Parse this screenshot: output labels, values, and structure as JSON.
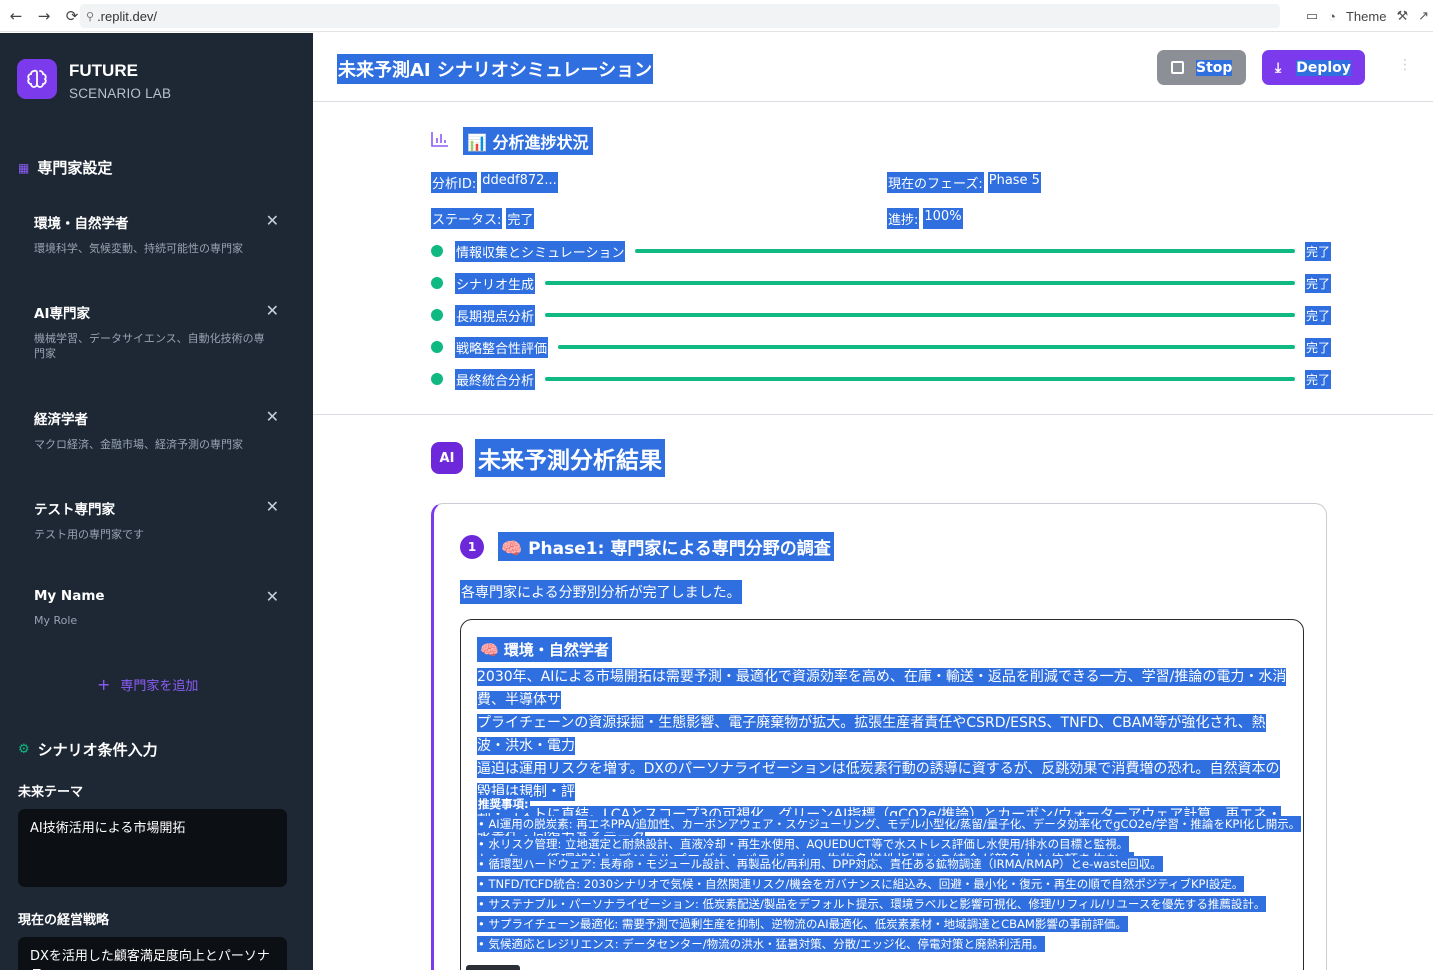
{
  "browser": {
    "url": ".replit.dev/",
    "theme_label": "Theme"
  },
  "sidebar": {
    "brand_title": "FUTURE",
    "brand_subtitle": "SCENARIO LAB",
    "experts_section_title": "専門家設定",
    "experts": [
      {
        "name": "環境・自然学者",
        "desc": "環境科学、気候変動、持続可能性の専門家"
      },
      {
        "name": "AI専門家",
        "desc": "機械学習、データサイエンス、自動化技術の専門家"
      },
      {
        "name": "経済学者",
        "desc": "マクロ経済、金融市場、経済予測の専門家"
      },
      {
        "name": "テスト専門家",
        "desc": "テスト用の専門家です"
      },
      {
        "name": "My Name",
        "desc": "My Role"
      }
    ],
    "add_expert_label": "専門家を追加",
    "scenario_section_title": "シナリオ条件入力",
    "future_theme_label": "未来テーマ",
    "future_theme_value": "AI技術活用による市場開拓",
    "strategy_label": "現在の経営戦略",
    "strategy_value": "DXを活用した顧客満足度向上とパーソナラ"
  },
  "header": {
    "title": "未来予測AI シナリオシミュレーション",
    "stop_label": "Stop",
    "deploy_label": "Deploy"
  },
  "progress": {
    "title": "📊 分析進捗状況",
    "analysis_id_label": "分析ID:",
    "analysis_id_value": "ddedf872...",
    "phase_label": "現在のフェーズ:",
    "phase_value": "Phase 5",
    "status_label": "ステータス:",
    "status_value": "完了",
    "progress_label": "進捗:",
    "progress_value": "100%",
    "steps": [
      {
        "label": "情報収集とシミュレーション",
        "status": "完了",
        "fraction": 1.0
      },
      {
        "label": "シナリオ生成",
        "status": "完了",
        "fraction": 1.0
      },
      {
        "label": "長期視点分析",
        "status": "完了",
        "fraction": 1.0
      },
      {
        "label": "戦略整合性評価",
        "status": "完了",
        "fraction": 1.0
      },
      {
        "label": "最終統合分析",
        "status": "完了",
        "fraction": 1.0
      }
    ]
  },
  "results": {
    "badge": "AI",
    "title": "未来予測分析結果",
    "phase": {
      "number": "1",
      "title": "🧠 Phase1: 専門家による専門分野の調査",
      "desc": "各専門家による分野別分析が完了しました。",
      "expert_card": {
        "title": "🧠 環境・自然学者",
        "body": [
          "2030年、AIによる市場開拓は需要予測・最適化で資源効率を高め、在庫・輸送・返品を削減できる一方、学習/推論の電力・水消費、半導体サ",
          "プライチェーンの資源採掘・生態影響、電子廃棄物が拡大。拡張生産者責任やCSRD/ESRS、TNFD、CBAM等が強化され、熱波・洪水・電力",
          "逼迫は運用リスクを増す。DXのパーソナライゼーションは低炭素行動の誘導に資するが、反跳効果で消費増の恐れ。自然資本の毀損は規制・評",
          "判・コストに直結。LCAとスコープ3の可視化、グリーンAI指標（gCO2e/推論）とカーボン/ウォーターアウェア計算、再エネ・水責任・回復力あるデータ",
          "センター、循環設計とデジタルプロダクトパスポート、生物多様性指標との統合が競争力と信頼を生む。"
        ],
        "recommendations_title": "推奨事項:",
        "recommendations": [
          "• AI運用の脱炭素: 再エネPPA/追加性、カーボンアウェア・スケジューリング、モデル小型化/蒸留/量子化、データ効率化でgCO2e/学習・推論をKPI化し開示。",
          "• 水リスク管理: 立地選定と耐熱設計、直液冷却・再生水使用、AQUEDUCT等で水ストレス評価し水使用/排水の目標と監視。",
          "• 循環型ハードウェア: 長寿命・モジュール設計、再製品化/再利用、DPP対応、責任ある鉱物調達（IRMA/RMAP）とe-waste回収。",
          "• TNFD/TCFD統合: 2030シナリオで気候・自然関連リスク/機会をガバナンスに組込み、回避・最小化・復元・再生の順で自然ポジティブKPI設定。",
          "• サステナブル・パーソナライゼーション: 低炭素配送/製品をデフォルト提示、環境ラベルと影響可視化、修理/リフィル/リユースを優先する推薦設計。",
          "• サプライチェーン最適化: 需要予測で過剰生産を抑制、逆物流のAI最適化、低炭素素材・地域調達とCBAM影響の事前評価。",
          "• 気候適応とレジリエンス: データセンター/物流の洪水・猛暑対策、分散/エッジ化、停電対策と廃熱利活用。"
        ]
      }
    }
  },
  "colors": {
    "accent": "#7c3aed",
    "sidebar_bg": "#1e2835",
    "progress_green": "#10b981",
    "selection": "#2f6fdf"
  }
}
